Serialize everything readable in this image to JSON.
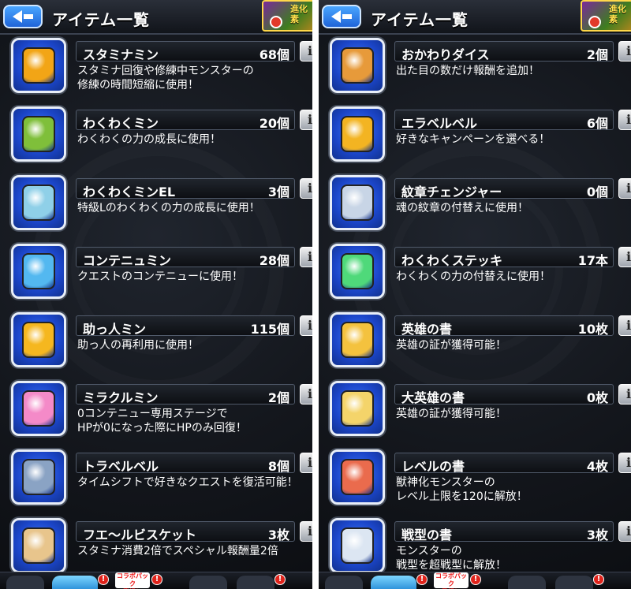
{
  "left": {
    "title": "アイテム一覧",
    "evo_badge": "進化\n素",
    "items": [
      {
        "name": "スタミナミン",
        "count": "68個",
        "desc": "スタミナ回復や修練中モンスターの\n修練の時間短縮に使用！",
        "icon": "stamina-can-icon",
        "color": "#f2a516"
      },
      {
        "name": "わくわくミン",
        "count": "20個",
        "desc": "わくわくの力の成長に使用！",
        "icon": "sprout-bottle-icon",
        "color": "#7fbf3a"
      },
      {
        "name": "わくわくミンEL",
        "count": "3個",
        "desc": "特級Lのわくわくの力の成長に使用！",
        "icon": "sprout-bottle-el-icon",
        "color": "#8fd0e8"
      },
      {
        "name": "コンテニュミン",
        "count": "28個",
        "desc": "クエストのコンテニューに使用！",
        "icon": "continue-potion-icon",
        "color": "#53b8f0"
      },
      {
        "name": "助っ人ミン",
        "count": "115個",
        "desc": "助っ人の再利用に使用！",
        "icon": "helper-bottle-icon",
        "color": "#f5b71f"
      },
      {
        "name": "ミラクルミン",
        "count": "2個",
        "desc": "0コンテニュー専用ステージで\nHPが0になった際にHPのみ回復！",
        "icon": "miracle-heart-potion-icon",
        "color": "#f48ac8"
      },
      {
        "name": "トラベルベル",
        "count": "8個",
        "desc": "タイムシフトで好きなクエストを復活可能！",
        "icon": "travel-bell-icon",
        "color": "#8aa3c4"
      },
      {
        "name": "フエ〜ルビスケット",
        "count": "3枚",
        "desc": "スタミナ消費2倍でスペシャル報酬量2倍",
        "icon": "biscuit-icon",
        "color": "#e8c58c"
      }
    ],
    "bottom": {
      "collab": "コラボパック\n登場！",
      "alert": "!"
    }
  },
  "right": {
    "title": "アイテム一覧",
    "evo_badge": "進化\n素",
    "items": [
      {
        "name": "おかわりダイス",
        "count": "2個",
        "desc": "出た目の数だけ報酬を追加！",
        "icon": "dice-icon",
        "color": "#e79a3a"
      },
      {
        "name": "エラベルベル",
        "count": "6個",
        "desc": "好きなキャンペーンを選べる！",
        "icon": "gold-bell-icon",
        "color": "#f3b422"
      },
      {
        "name": "紋章チェンジャー",
        "count": "0個",
        "desc": "魂の紋章の付替えに使用！",
        "icon": "emblem-changer-icon",
        "color": "#c8d5e6"
      },
      {
        "name": "わくわくステッキ",
        "count": "17本",
        "desc": "わくわくの力の付替えに使用！",
        "icon": "magic-wand-icon",
        "color": "#4fd97a"
      },
      {
        "name": "英雄の書",
        "count": "10枚",
        "desc": "英雄の証が獲得可能！",
        "icon": "hero-scroll-icon",
        "color": "#f4c23e"
      },
      {
        "name": "大英雄の書",
        "count": "0枚",
        "desc": "英雄の証が獲得可能！",
        "icon": "great-hero-scroll-icon",
        "color": "#f4d46a"
      },
      {
        "name": "レベルの書",
        "count": "4枚",
        "desc": "獣神化モンスターの\nレベル上限を120に解放！",
        "icon": "level-scroll-icon",
        "color": "#ea6b4d"
      },
      {
        "name": "戦型の書",
        "count": "3枚",
        "desc": "モンスターの\n戦型を超戦型に解放！",
        "icon": "battle-type-scroll-icon",
        "color": "#dce6f2"
      }
    ],
    "bottom": {
      "collab": "コラボパック\n登場！",
      "alert": "!"
    }
  }
}
